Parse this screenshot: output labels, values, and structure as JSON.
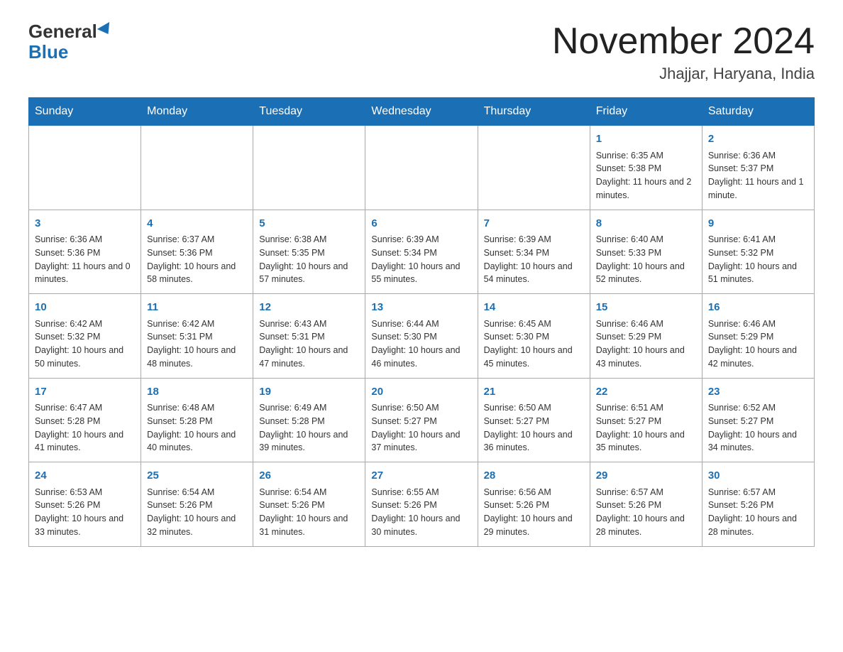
{
  "header": {
    "logo_general": "General",
    "logo_blue": "Blue",
    "month_title": "November 2024",
    "location": "Jhajjar, Haryana, India"
  },
  "weekdays": [
    "Sunday",
    "Monday",
    "Tuesday",
    "Wednesday",
    "Thursday",
    "Friday",
    "Saturday"
  ],
  "weeks": [
    [
      {
        "day": "",
        "info": ""
      },
      {
        "day": "",
        "info": ""
      },
      {
        "day": "",
        "info": ""
      },
      {
        "day": "",
        "info": ""
      },
      {
        "day": "",
        "info": ""
      },
      {
        "day": "1",
        "info": "Sunrise: 6:35 AM\nSunset: 5:38 PM\nDaylight: 11 hours and 2 minutes."
      },
      {
        "day": "2",
        "info": "Sunrise: 6:36 AM\nSunset: 5:37 PM\nDaylight: 11 hours and 1 minute."
      }
    ],
    [
      {
        "day": "3",
        "info": "Sunrise: 6:36 AM\nSunset: 5:36 PM\nDaylight: 11 hours and 0 minutes."
      },
      {
        "day": "4",
        "info": "Sunrise: 6:37 AM\nSunset: 5:36 PM\nDaylight: 10 hours and 58 minutes."
      },
      {
        "day": "5",
        "info": "Sunrise: 6:38 AM\nSunset: 5:35 PM\nDaylight: 10 hours and 57 minutes."
      },
      {
        "day": "6",
        "info": "Sunrise: 6:39 AM\nSunset: 5:34 PM\nDaylight: 10 hours and 55 minutes."
      },
      {
        "day": "7",
        "info": "Sunrise: 6:39 AM\nSunset: 5:34 PM\nDaylight: 10 hours and 54 minutes."
      },
      {
        "day": "8",
        "info": "Sunrise: 6:40 AM\nSunset: 5:33 PM\nDaylight: 10 hours and 52 minutes."
      },
      {
        "day": "9",
        "info": "Sunrise: 6:41 AM\nSunset: 5:32 PM\nDaylight: 10 hours and 51 minutes."
      }
    ],
    [
      {
        "day": "10",
        "info": "Sunrise: 6:42 AM\nSunset: 5:32 PM\nDaylight: 10 hours and 50 minutes."
      },
      {
        "day": "11",
        "info": "Sunrise: 6:42 AM\nSunset: 5:31 PM\nDaylight: 10 hours and 48 minutes."
      },
      {
        "day": "12",
        "info": "Sunrise: 6:43 AM\nSunset: 5:31 PM\nDaylight: 10 hours and 47 minutes."
      },
      {
        "day": "13",
        "info": "Sunrise: 6:44 AM\nSunset: 5:30 PM\nDaylight: 10 hours and 46 minutes."
      },
      {
        "day": "14",
        "info": "Sunrise: 6:45 AM\nSunset: 5:30 PM\nDaylight: 10 hours and 45 minutes."
      },
      {
        "day": "15",
        "info": "Sunrise: 6:46 AM\nSunset: 5:29 PM\nDaylight: 10 hours and 43 minutes."
      },
      {
        "day": "16",
        "info": "Sunrise: 6:46 AM\nSunset: 5:29 PM\nDaylight: 10 hours and 42 minutes."
      }
    ],
    [
      {
        "day": "17",
        "info": "Sunrise: 6:47 AM\nSunset: 5:28 PM\nDaylight: 10 hours and 41 minutes."
      },
      {
        "day": "18",
        "info": "Sunrise: 6:48 AM\nSunset: 5:28 PM\nDaylight: 10 hours and 40 minutes."
      },
      {
        "day": "19",
        "info": "Sunrise: 6:49 AM\nSunset: 5:28 PM\nDaylight: 10 hours and 39 minutes."
      },
      {
        "day": "20",
        "info": "Sunrise: 6:50 AM\nSunset: 5:27 PM\nDaylight: 10 hours and 37 minutes."
      },
      {
        "day": "21",
        "info": "Sunrise: 6:50 AM\nSunset: 5:27 PM\nDaylight: 10 hours and 36 minutes."
      },
      {
        "day": "22",
        "info": "Sunrise: 6:51 AM\nSunset: 5:27 PM\nDaylight: 10 hours and 35 minutes."
      },
      {
        "day": "23",
        "info": "Sunrise: 6:52 AM\nSunset: 5:27 PM\nDaylight: 10 hours and 34 minutes."
      }
    ],
    [
      {
        "day": "24",
        "info": "Sunrise: 6:53 AM\nSunset: 5:26 PM\nDaylight: 10 hours and 33 minutes."
      },
      {
        "day": "25",
        "info": "Sunrise: 6:54 AM\nSunset: 5:26 PM\nDaylight: 10 hours and 32 minutes."
      },
      {
        "day": "26",
        "info": "Sunrise: 6:54 AM\nSunset: 5:26 PM\nDaylight: 10 hours and 31 minutes."
      },
      {
        "day": "27",
        "info": "Sunrise: 6:55 AM\nSunset: 5:26 PM\nDaylight: 10 hours and 30 minutes."
      },
      {
        "day": "28",
        "info": "Sunrise: 6:56 AM\nSunset: 5:26 PM\nDaylight: 10 hours and 29 minutes."
      },
      {
        "day": "29",
        "info": "Sunrise: 6:57 AM\nSunset: 5:26 PM\nDaylight: 10 hours and 28 minutes."
      },
      {
        "day": "30",
        "info": "Sunrise: 6:57 AM\nSunset: 5:26 PM\nDaylight: 10 hours and 28 minutes."
      }
    ]
  ]
}
